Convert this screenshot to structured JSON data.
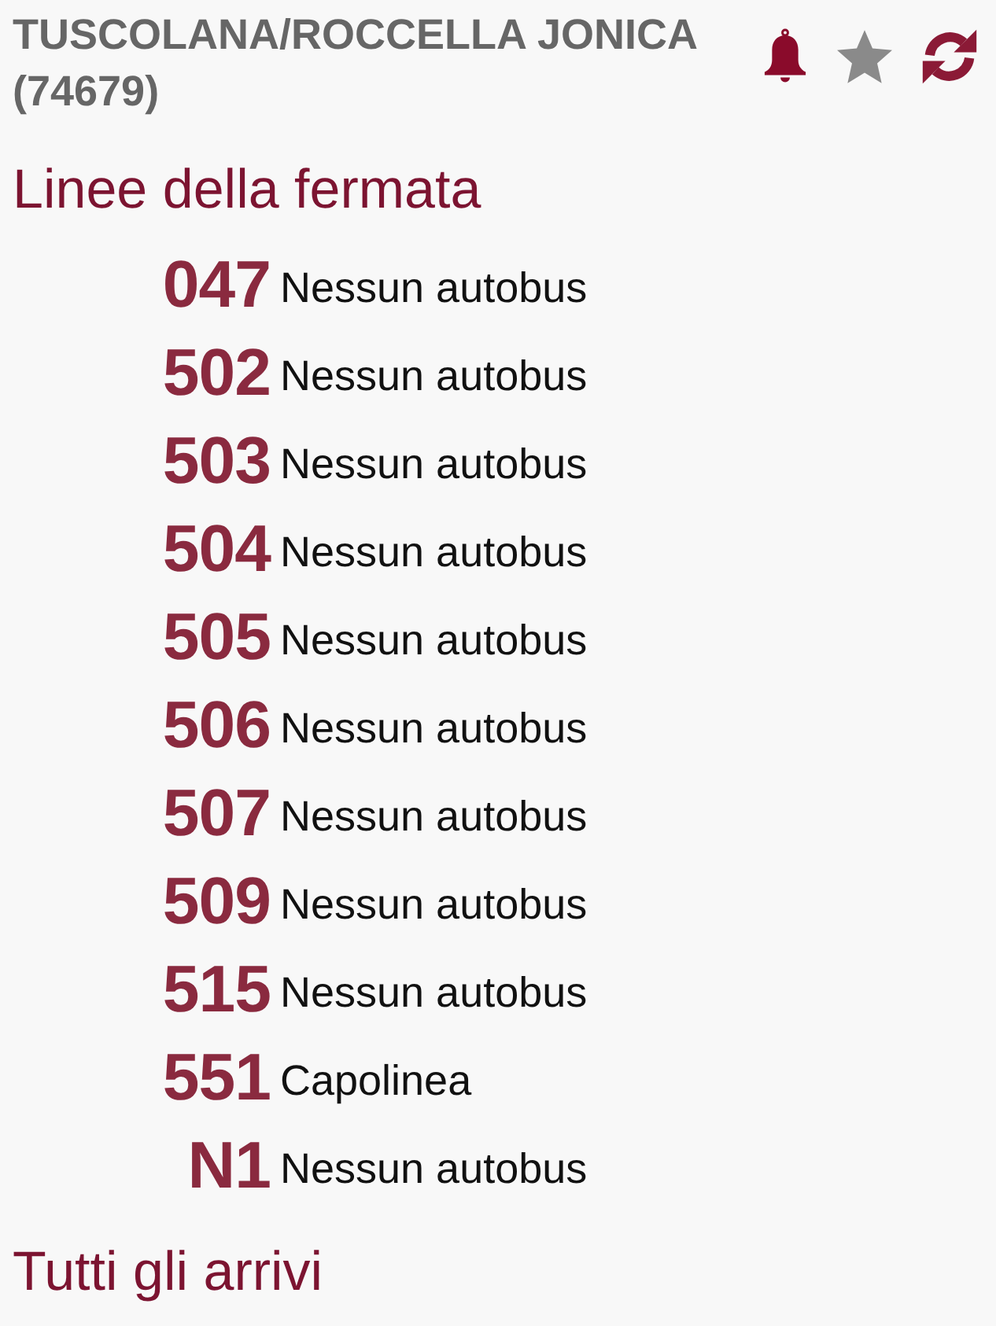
{
  "header": {
    "title": "TUSCOLANA/ROCCELLA JONICA (74679)",
    "favorite": false
  },
  "lines_section": {
    "heading": "Linee della fermata",
    "lines": [
      {
        "number": "047",
        "status": "Nessun autobus"
      },
      {
        "number": "502",
        "status": "Nessun autobus"
      },
      {
        "number": "503",
        "status": "Nessun autobus"
      },
      {
        "number": "504",
        "status": "Nessun autobus"
      },
      {
        "number": "505",
        "status": "Nessun autobus"
      },
      {
        "number": "506",
        "status": "Nessun autobus"
      },
      {
        "number": "507",
        "status": "Nessun autobus"
      },
      {
        "number": "509",
        "status": "Nessun autobus"
      },
      {
        "number": "515",
        "status": "Nessun autobus"
      },
      {
        "number": "551",
        "status": "Capolinea"
      },
      {
        "number": "N1",
        "status": "Nessun autobus"
      }
    ]
  },
  "arrivals_section": {
    "heading": "Tutti gli arrivi"
  }
}
